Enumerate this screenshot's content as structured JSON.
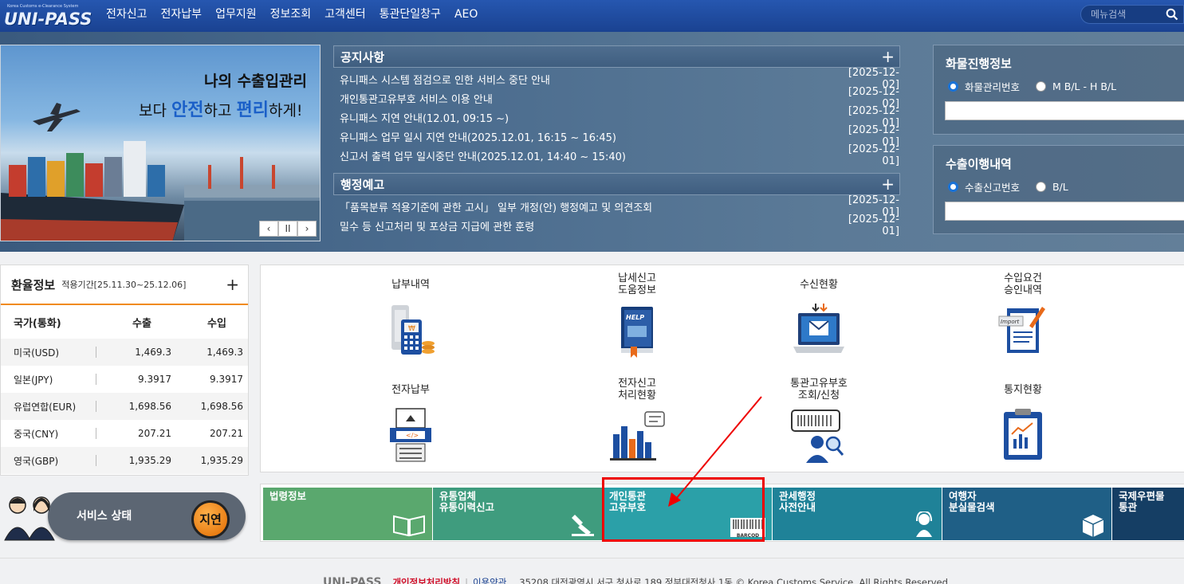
{
  "header": {
    "logo_small": "Korea Customs e-Clearance System",
    "logo_text": "UNI-PASS",
    "nav": [
      "전자신고",
      "전자납부",
      "업무지원",
      "정보조회",
      "고객센터",
      "통관단일창구",
      "AEO"
    ],
    "search_placeholder": "메뉴검색"
  },
  "banner": {
    "line1": "나의 수출입관리",
    "line2_pre": "보다 ",
    "line2_b1": "안전",
    "line2_mid": "하고 ",
    "line2_b2": "편리",
    "line2_post": "하게!",
    "controls": [
      "‹",
      "II",
      "›"
    ]
  },
  "notices": {
    "title": "공지사항",
    "items": [
      {
        "text": "유니패스 시스템 점검으로 인한 서비스 중단 안내",
        "date": "[2025-12-02]"
      },
      {
        "text": "개인통관고유부호 서비스 이용 안내",
        "date": "[2025-12-02]"
      },
      {
        "text": "유니패스 지연 안내(12.01, 09:15 ~)",
        "date": "[2025-12-01]"
      },
      {
        "text": "유니패스 업무 일시 지연 안내(2025.12.01, 16:15 ~ 16:45)",
        "date": "[2025-12-01]"
      },
      {
        "text": "신고서 출력 업무 일시중단 안내(2025.12.01, 14:40 ~ 15:40)",
        "date": "[2025-12-01]"
      }
    ]
  },
  "admin_notices": {
    "title": "행정예고",
    "items": [
      {
        "text": "「품목분류 적용기준에 관한 고시」 일부 개정(안) 행정예고 및 의견조회",
        "date": "[2025-12-01]"
      },
      {
        "text": "밀수 등 신고처리 및 포상금 지급에 관한 훈령",
        "date": "[2025-12-01]"
      }
    ]
  },
  "cargo": {
    "title": "화물진행정보",
    "options": [
      "화물관리번호",
      "M B/L - H B/L"
    ]
  },
  "export_history": {
    "title": "수출이행내역",
    "options": [
      "수출신고번호",
      "B/L"
    ]
  },
  "exchange": {
    "title": "환율정보",
    "period": "적용기간[25.11.30~25.12.06]",
    "headers": [
      "국가(통화)",
      "수출",
      "수입"
    ],
    "rows": [
      {
        "country": "미국(USD)",
        "export": "1,469.3",
        "import": "1,469.3"
      },
      {
        "country": "일본(JPY)",
        "export": "9.3917",
        "import": "9.3917"
      },
      {
        "country": "유럽연합(EUR)",
        "export": "1,698.56",
        "import": "1,698.56"
      },
      {
        "country": "중국(CNY)",
        "export": "207.21",
        "import": "207.21"
      },
      {
        "country": "영국(GBP)",
        "export": "1,935.29",
        "import": "1,935.29"
      }
    ]
  },
  "quick": [
    {
      "label": "납부내역",
      "icon": "payment-terminal-icon"
    },
    {
      "label": "납세신고\n도움정보",
      "icon": "help-book-icon"
    },
    {
      "label": "수신현황",
      "icon": "laptop-mail-icon"
    },
    {
      "label": "수입요건\n승인내역",
      "icon": "import-doc-icon"
    },
    {
      "label": "전자납부",
      "icon": "scanner-icon"
    },
    {
      "label": "전자신고\n처리현황",
      "icon": "bar-chart-icon"
    },
    {
      "label": "통관고유부호\n조회/신청",
      "icon": "barcode-person-icon"
    },
    {
      "label": "통지현황",
      "icon": "clipboard-chart-icon"
    }
  ],
  "service": {
    "label": "서비스 상태",
    "status": "지연"
  },
  "tiles": [
    {
      "line1": "법령정보",
      "line2": "",
      "color": "#5aa86e"
    },
    {
      "line1": "유통업체",
      "line2": "유통이력신고",
      "color": "#3f9c7e"
    },
    {
      "line1": "개인통관",
      "line2": "고유부호",
      "color": "#2ba0a8",
      "badge": "BARCOD"
    },
    {
      "line1": "관세행정",
      "line2": "사전안내",
      "color": "#1f8298"
    },
    {
      "line1": "여행자",
      "line2": "분실물검색",
      "color": "#1f5f86"
    },
    {
      "line1": "국제우편물",
      "line2": "통관",
      "color": "#153e64"
    }
  ],
  "footer": {
    "logo": "UNI-PASS",
    "privacy": "개인정보처리방침",
    "terms": "이용약관",
    "address": "35208 대전광역시 서구 청사로 189 정부대전청사 1동 © Korea Customs Service. All Rights Reserved."
  }
}
